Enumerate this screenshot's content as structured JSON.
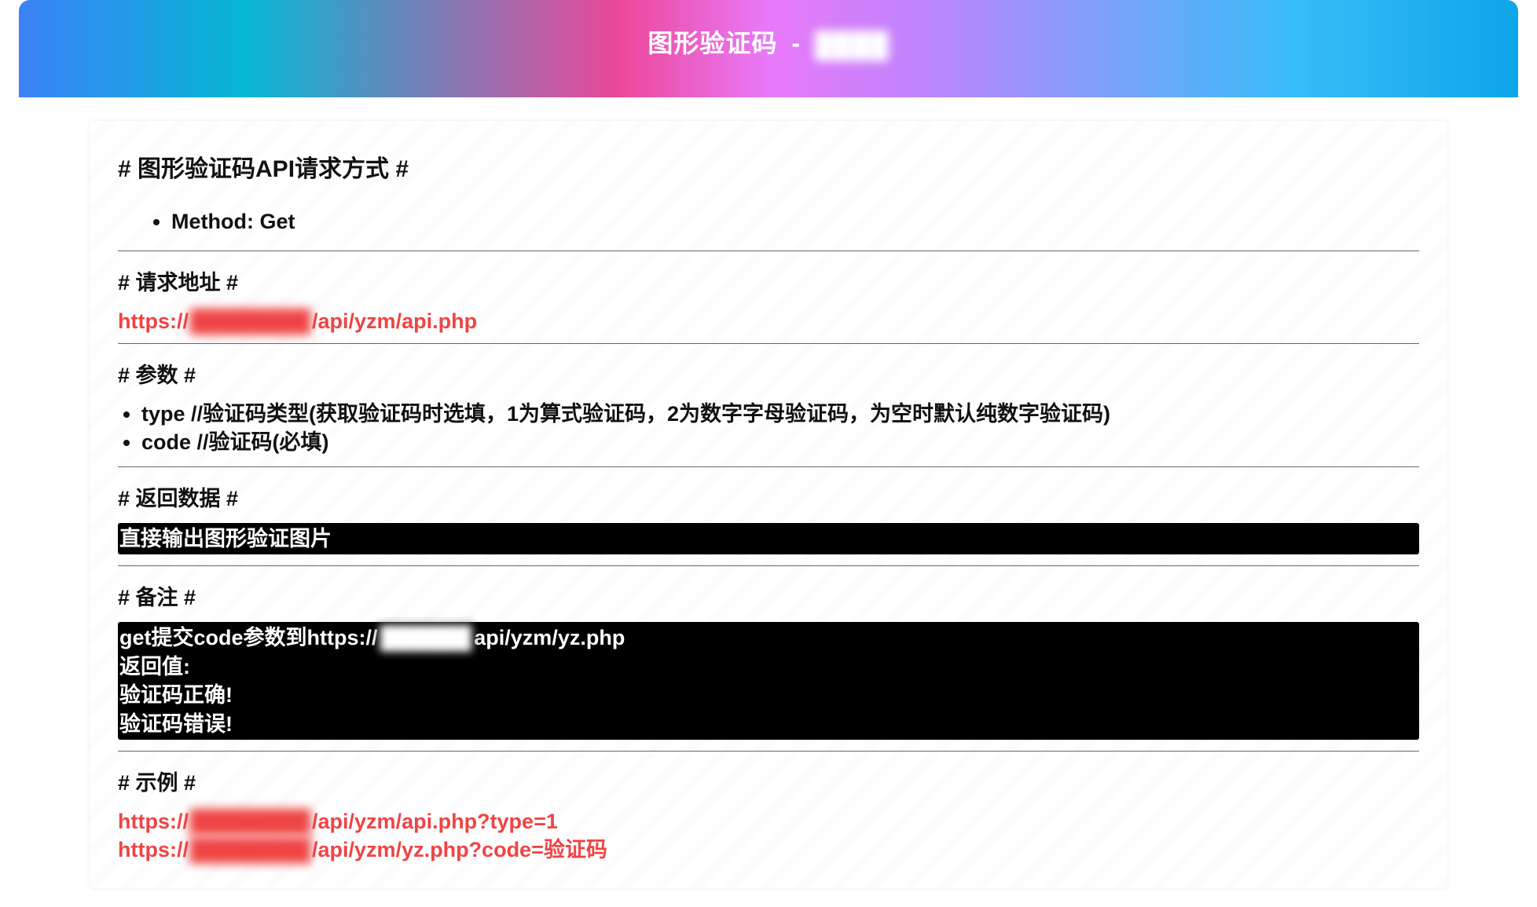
{
  "header": {
    "title_left": "图形验证码",
    "separator": "-",
    "title_right_blurred": "████"
  },
  "sections": {
    "request_method": {
      "heading": "# 图形验证码API请求方式 #",
      "method_label": "Method: Get"
    },
    "request_url": {
      "heading": "# 请求地址 #",
      "url_prefix": "https://",
      "url_blurred": "████████",
      "url_suffix": "/api/yzm/api.php"
    },
    "params": {
      "heading": "# 参数 #",
      "items": [
        "type //验证码类型(获取验证码时选填，1为算式验证码，2为数字字母验证码，为空时默认纯数字验证码)",
        "code //验证码(必填)"
      ]
    },
    "return_data": {
      "heading": "# 返回数据 #",
      "body": "直接输出图形验证图片"
    },
    "remark": {
      "heading": "# 备注 #",
      "line1_pre": "get提交code参数到https://",
      "line1_blur": "██████",
      "line1_post": "api/yzm/yz.php",
      "line2": "返回值:",
      "line3": "验证码正确!",
      "line4": "验证码错误!"
    },
    "example": {
      "heading": "# 示例 #",
      "ex1_prefix": "https://",
      "ex1_blur": "████████",
      "ex1_suffix": "/api/yzm/api.php?type=1",
      "ex2_prefix": "https://",
      "ex2_blur": "████████",
      "ex2_suffix": "/api/yzm/yz.php?code=验证码"
    }
  }
}
